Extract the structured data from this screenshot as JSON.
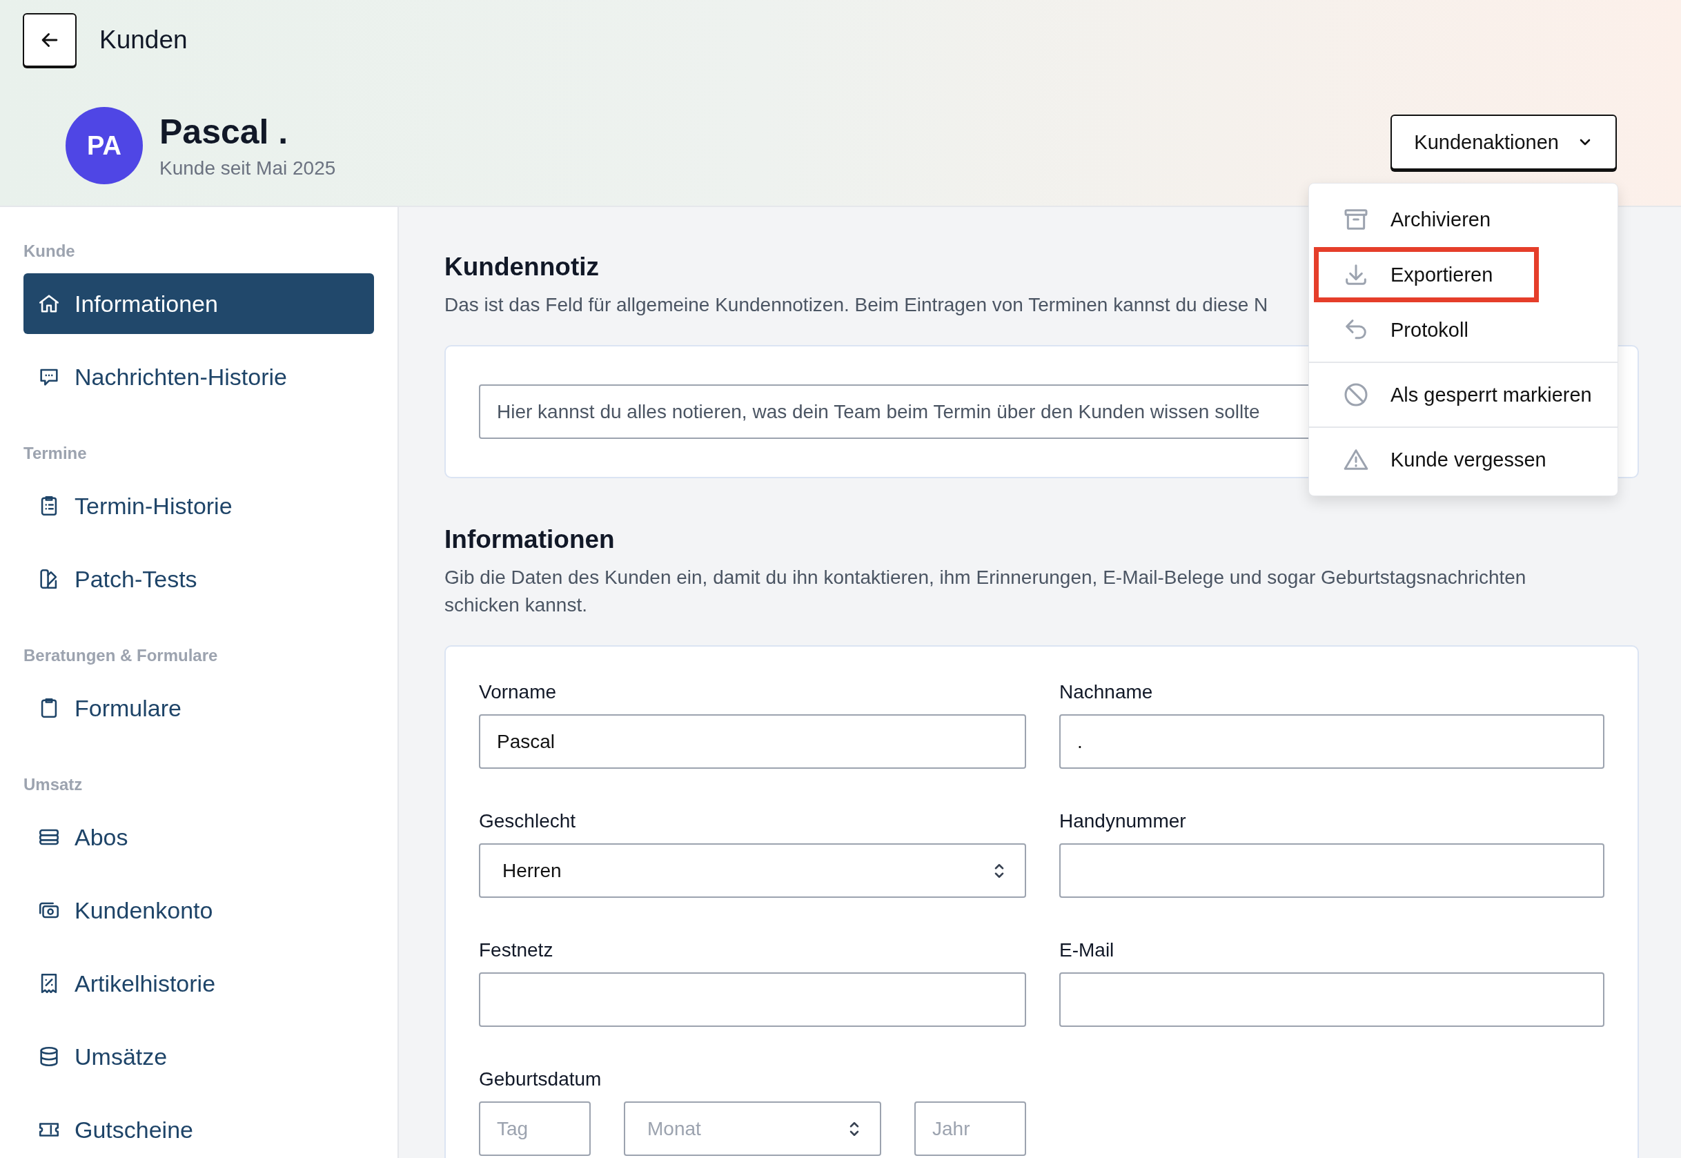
{
  "header": {
    "back_title": "Kunden",
    "avatar_initials": "PA",
    "name": "Pascal .",
    "subtitle": "Kunde seit Mai 2025",
    "actions_button": "Kundenaktionen"
  },
  "actions_menu": {
    "groups": [
      {
        "items": [
          {
            "label": "Archivieren",
            "highlighted": false
          },
          {
            "label": "Exportieren",
            "highlighted": true
          },
          {
            "label": "Protokoll",
            "highlighted": false
          }
        ]
      },
      {
        "items": [
          {
            "label": "Als gesperrt markieren",
            "highlighted": false
          }
        ]
      },
      {
        "items": [
          {
            "label": "Kunde vergessen",
            "highlighted": false
          }
        ]
      }
    ]
  },
  "sidebar": {
    "groups": [
      {
        "title": "Kunde",
        "items": [
          {
            "label": "Informationen",
            "selected": true
          },
          {
            "label": "Nachrichten-Historie",
            "selected": false
          }
        ]
      },
      {
        "title": "Termine",
        "items": [
          {
            "label": "Termin-Historie",
            "selected": false
          },
          {
            "label": "Patch-Tests",
            "selected": false
          }
        ]
      },
      {
        "title": "Beratungen & Formulare",
        "items": [
          {
            "label": "Formulare",
            "selected": false
          }
        ]
      },
      {
        "title": "Umsatz",
        "items": [
          {
            "label": "Abos",
            "selected": false
          },
          {
            "label": "Kundenkonto",
            "selected": false
          },
          {
            "label": "Artikelhistorie",
            "selected": false
          },
          {
            "label": "Umsätze",
            "selected": false
          },
          {
            "label": "Gutscheine",
            "selected": false
          }
        ]
      }
    ]
  },
  "note_section": {
    "title": "Kundennotiz",
    "description": "Das ist das Feld für allgemeine Kundennotizen. Beim Eintragen von Terminen kannst du diese N",
    "placeholder": "Hier kannst du alles notieren, was dein Team beim Termin über den Kunden wissen sollte"
  },
  "info_section": {
    "title": "Informationen",
    "description": "Gib die Daten des Kunden ein, damit du ihn kontaktieren, ihm Erinnerungen, E-Mail-Belege und sogar Geburtstagsnachrichten schicken kannst.",
    "fields": [
      {
        "kind": "text",
        "label": "Vorname",
        "value": "Pascal"
      },
      {
        "kind": "text",
        "label": "Nachname",
        "value": "."
      },
      {
        "kind": "select",
        "label": "Geschlecht",
        "value": "Herren"
      },
      {
        "kind": "text",
        "label": "Handynummer"
      },
      {
        "kind": "text",
        "label": "Festnetz"
      },
      {
        "kind": "text",
        "label": "E-Mail"
      },
      {
        "kind": "date",
        "label": "Geburtsdatum",
        "parts": [
          {
            "kind": "text",
            "placeholder": "Tag"
          },
          {
            "kind": "select",
            "placeholder": "Monat"
          },
          {
            "kind": "text",
            "placeholder": "Jahr"
          }
        ]
      }
    ]
  }
}
